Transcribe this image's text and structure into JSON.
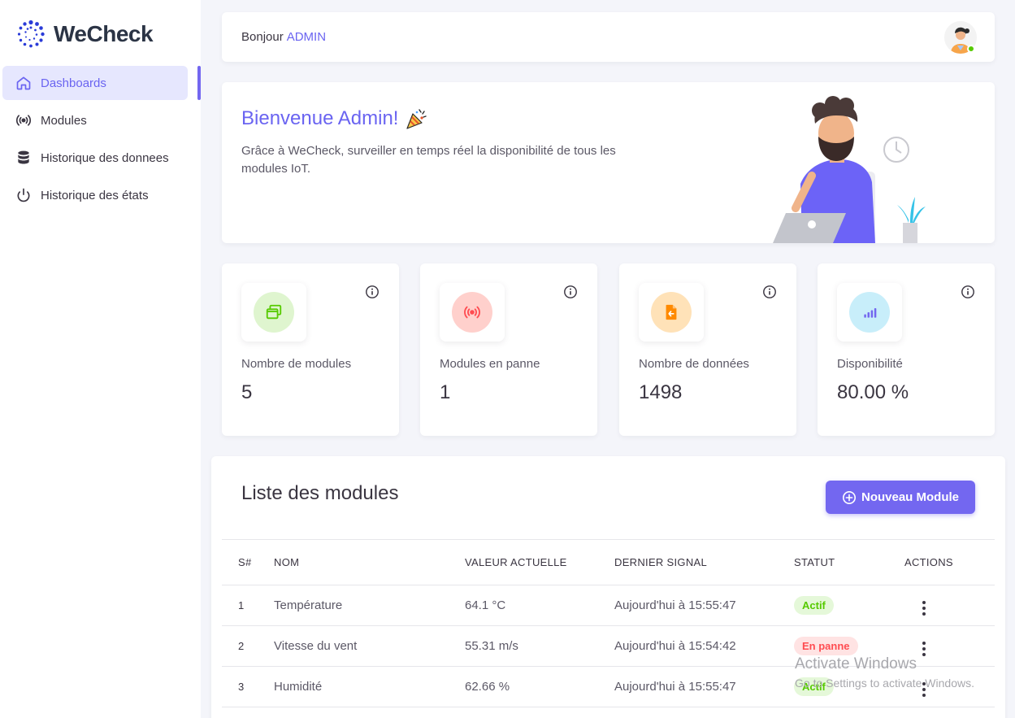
{
  "app": {
    "title": "WeCheck"
  },
  "sidebar": {
    "items": [
      {
        "label": "Dashboards",
        "icon": "home-icon",
        "active": true
      },
      {
        "label": "Modules",
        "icon": "broadcast-icon"
      },
      {
        "label": "Historique des donnees",
        "icon": "database-icon"
      },
      {
        "label": "Historique des états",
        "icon": "power-icon"
      }
    ]
  },
  "header": {
    "greeting": "Bonjour",
    "user": "ADMIN"
  },
  "welcome": {
    "title": "Bienvenue Admin!",
    "text": "Grâce à WeCheck, surveiller en temps réel la disponibilité de tous les modules IoT."
  },
  "stats": [
    {
      "label": "Nombre de modules",
      "value": "5",
      "icon": "windows-icon",
      "color": "#56ca00"
    },
    {
      "label": "Modules en panne",
      "value": "1",
      "icon": "broadcast-icon",
      "color": "#ff4c51"
    },
    {
      "label": "Nombre de données",
      "value": "1498",
      "icon": "file-import-icon",
      "color": "#ff8a00"
    },
    {
      "label": "Disponibilité",
      "value": "80.00 %",
      "icon": "signal-icon",
      "color": "#7367f0"
    }
  ],
  "modules": {
    "title": "Liste des modules",
    "new_button": "Nouveau Module",
    "columns": [
      "S#",
      "NOM",
      "VALEUR ACTUELLE",
      "DERNIER SIGNAL",
      "STATUT",
      "ACTIONS"
    ],
    "rows": [
      {
        "id": "1",
        "name": "Température",
        "value": "64.1 °C",
        "signal": "Aujourd'hui à 15:55:47",
        "status": "Actif",
        "state": "actif"
      },
      {
        "id": "2",
        "name": "Vitesse du vent",
        "value": "55.31 m/s",
        "signal": "Aujourd'hui à 15:54:42",
        "status": "En panne",
        "state": "panne"
      },
      {
        "id": "3",
        "name": "Humidité",
        "value": "62.66 %",
        "signal": "Aujourd'hui à 15:55:47",
        "status": "Actif",
        "state": "actif"
      }
    ]
  },
  "watermark": {
    "line1": "Activate Windows",
    "line2": "Go to Settings to activate Windows."
  }
}
